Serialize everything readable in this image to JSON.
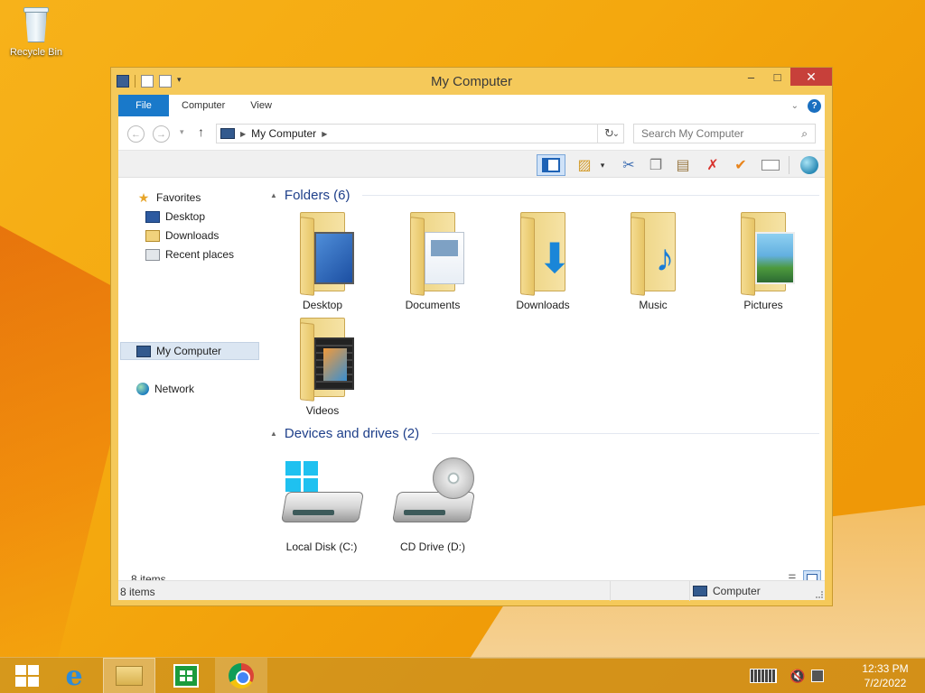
{
  "desktop": {
    "icons": [
      {
        "label": "Recycle Bin",
        "icon": "recycle-bin-icon"
      }
    ]
  },
  "window": {
    "title": "My Computer",
    "controls": {
      "minimize": "–",
      "maximize": "□",
      "close": "✕"
    },
    "ribbon_tabs": [
      "File",
      "Computer",
      "View"
    ],
    "help_label": "?",
    "address": {
      "back": "←",
      "forward": "→",
      "up": "↑",
      "location": "My Computer",
      "refresh": "↻"
    },
    "search": {
      "placeholder": "Search My Computer"
    },
    "nav_pane": {
      "favorites_label": "Favorites",
      "favorites": [
        "Desktop",
        "Downloads",
        "Recent places"
      ],
      "computer_label": "My Computer",
      "network_label": "Network"
    },
    "sections": {
      "folders_header": "Folders (6)",
      "folders": [
        "Desktop",
        "Documents",
        "Downloads",
        "Music",
        "Pictures",
        "Videos"
      ],
      "devices_header": "Devices and drives (2)",
      "drives": [
        "Local Disk (C:)",
        "CD Drive (D:)"
      ]
    },
    "item_count": "8 items",
    "status": {
      "left": "8 items",
      "right": "Computer"
    }
  },
  "taskbar": {
    "apps": [
      "start-button",
      "internet-explorer-icon",
      "file-explorer-icon",
      "store-icon",
      "chrome-icon"
    ],
    "clock": {
      "time": "12:33 PM",
      "date": "7/2/2022"
    }
  },
  "colors": {
    "accent": "#1979ca",
    "window_frame": "#f5c95a",
    "section_header": "#1e3f8a",
    "close_button": "#c7403a"
  }
}
